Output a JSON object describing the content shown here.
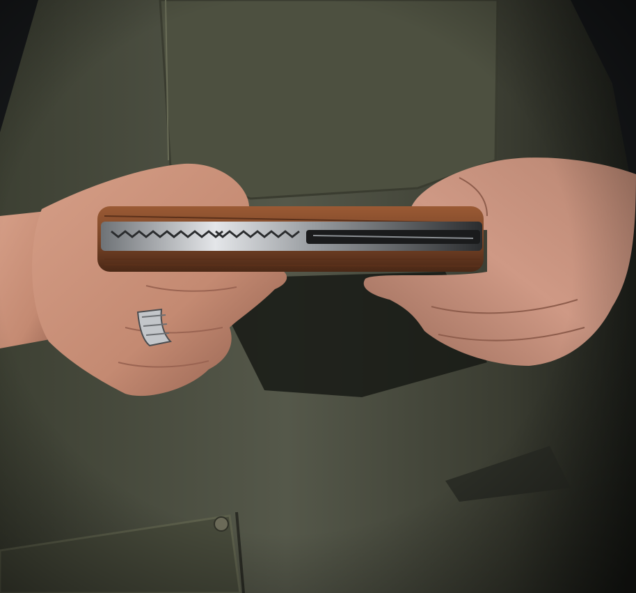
{
  "photo": {
    "subject": "hands-holding-folding-knife",
    "colors": {
      "background": "#16181a",
      "apron": "#4a4d3c",
      "apron_dark": "#2e3127",
      "apron_light": "#5d604c",
      "skin": "#c98f78",
      "skin_shadow": "#8e5d4c",
      "wood": "#7a4528",
      "wood_dark": "#4a2816",
      "steel": "#c9ccd0",
      "ring": "#bfc2c6"
    }
  }
}
